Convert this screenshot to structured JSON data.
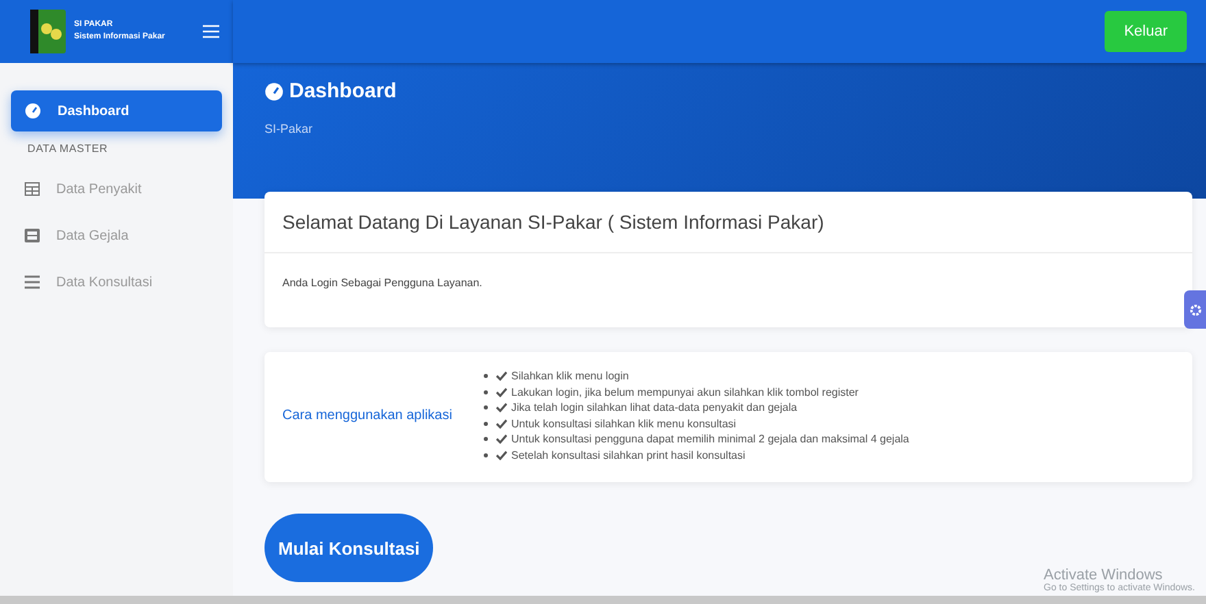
{
  "brand": {
    "title": "SI PAKAR",
    "subtitle": "Sistem Informasi Pakar"
  },
  "topbar": {
    "logout_button": "Keluar"
  },
  "sidebar": {
    "items": [
      {
        "label": "Dashboard",
        "kind": "link",
        "selected": true
      },
      {
        "label": "DATA MASTER",
        "kind": "heading"
      },
      {
        "label": "Data Penyakit",
        "kind": "link",
        "selected": false
      },
      {
        "label": "Data Gejala",
        "kind": "link",
        "selected": false
      },
      {
        "label": "Data Konsultasi",
        "kind": "link",
        "selected": false
      }
    ]
  },
  "header": {
    "title": "Dashboard",
    "breadcrumb": "SI-Pakar"
  },
  "welcome_card": {
    "title": "Selamat Datang Di Layanan SI-Pakar ( Sistem Informasi Pakar)",
    "body": "Anda Login Sebagai Pengguna Layanan."
  },
  "guide_card": {
    "title": "Cara menggunakan aplikasi",
    "steps": [
      "Silahkan klik menu login",
      "Lakukan login, jika belum mempunyai akun silahkan klik tombol register",
      "Jika telah login silahkan lihat data-data penyakit dan gejala",
      "Untuk konsultasi silahkan klik menu konsultasi",
      "Untuk konsultasi pengguna dapat memilih minimal 2 gejala dan maksimal 4 gejala",
      "Setelah konsultasi silahkan print hasil konsultasi"
    ]
  },
  "start_button": "Mulai Konsultasi",
  "activation_notice": {
    "title": "Activate Windows",
    "body": "Go to Settings to activate Windows."
  }
}
